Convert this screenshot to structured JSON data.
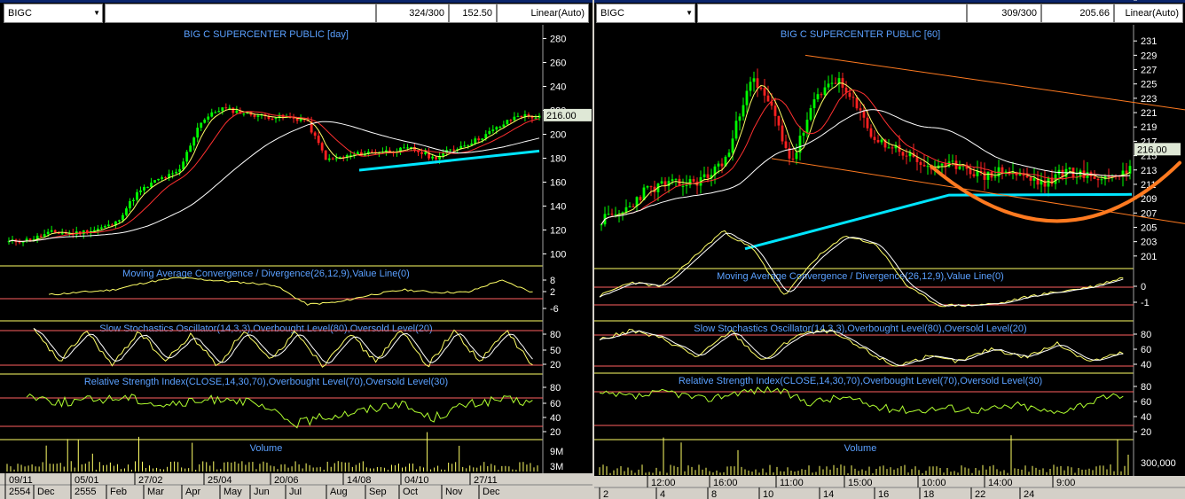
{
  "colors": {
    "bg": "#000000",
    "up": "#00ff00",
    "down": "#ff2020",
    "ma_short": "#ffff66",
    "ma_mid": "#ff3030",
    "ma_long": "#ffffff",
    "trend": "#00e5ff",
    "osc": "#ffff66",
    "osc2": "#ffffff",
    "rsi": "#b0ff30",
    "title": "#5aa0ff",
    "level": "#ff6060",
    "annot": "#ff7a20",
    "price_tag": "#dfe8d6"
  },
  "left": {
    "symbol": "BIGC",
    "count": "324/300",
    "price": "152.50",
    "scale": "Linear(Auto)",
    "title": "BIG C SUPERCENTER PUBLIC [day]",
    "last_price": "216.00",
    "y_ticks": [
      "280",
      "260",
      "240",
      "220",
      "200",
      "180",
      "160",
      "140",
      "120",
      "100"
    ],
    "macd_title": "Moving Average Convergence / Divergence(26,12,9),Value Line(0)",
    "macd_ticks": [
      "8",
      "2",
      "-6"
    ],
    "stoch_title": "Slow Stochastics Oscillator(14,3,3),Overbought Level(80),Oversold Level(20)",
    "stoch_ticks": [
      "80",
      "50",
      "20"
    ],
    "rsi_title": "Relative Strength Index(CLOSE,14,30,70),Overbought Level(70),Oversold Level(30)",
    "rsi_ticks": [
      "80",
      "60",
      "40",
      "20"
    ],
    "vol_title": "Volume",
    "vol_ticks": [
      "9M",
      "3M"
    ],
    "date_row1": [
      "09/11",
      "05/01",
      "27/02",
      "25/04",
      "20/06",
      "14/08",
      "04/10",
      "27/11"
    ],
    "date_row2": [
      "2554",
      "Dec",
      "2555",
      "Feb",
      "Mar",
      "Apr",
      "May",
      "Jun",
      "Jul",
      "Aug",
      "Sep",
      "Oct",
      "Nov",
      "Dec"
    ]
  },
  "right": {
    "symbol": "BIGC",
    "count": "309/300",
    "price": "205.66",
    "scale": "Linear(Auto)",
    "title": "BIG C SUPERCENTER PUBLIC [60]",
    "last_price": "216.00",
    "y_ticks": [
      "231",
      "229",
      "227",
      "225",
      "223",
      "221",
      "219",
      "217",
      "215",
      "213",
      "211",
      "209",
      "207",
      "205",
      "203",
      "201"
    ],
    "macd_title": "Moving Average Convergence / Divergence(26,12,9),Value Line(0)",
    "macd_ticks": [
      "0",
      "-1"
    ],
    "stoch_title": "Slow Stochastics Oscillator(14,3,3),Overbought Level(80),Oversold Level(20)",
    "stoch_ticks": [
      "80",
      "60",
      "40",
      "20"
    ],
    "rsi_title": "Relative Strength Index(CLOSE,14,30,70),Overbought Level(70),Oversold Level(30)",
    "rsi_ticks": [
      "80",
      "60",
      "40",
      "20"
    ],
    "vol_title": "Volume",
    "vol_ticks": [
      "300,000"
    ],
    "date_row1": [
      "12:00",
      "16:00",
      "11:00",
      "15:00",
      "10:00",
      "14:00",
      "9:00"
    ],
    "date_row2": [
      "2",
      "4",
      "8",
      "10",
      "14",
      "16",
      "18",
      "22",
      "24"
    ]
  },
  "chart_data": [
    {
      "type": "line",
      "title": "BIG C SUPERCENTER PUBLIC [day]",
      "xlabel": "",
      "ylabel": "",
      "ylim": [
        95,
        285
      ],
      "x": [
        "09/11",
        "05/01",
        "27/02",
        "25/04",
        "20/06",
        "14/08",
        "04/10",
        "27/11"
      ],
      "series": [
        {
          "name": "",
          "values": [
            112,
            118,
            162,
            210,
            212,
            178,
            188,
            216
          ]
        }
      ]
    },
    {
      "type": "line",
      "title": "BIG C SUPERCENTER PUBLIC [60]",
      "xlabel": "",
      "ylabel": "",
      "ylim": [
        200,
        232
      ],
      "x": [
        "12:00",
        "16:00",
        "11:00",
        "15:00",
        "10:00",
        "14:00",
        "9:00"
      ],
      "series": [
        {
          "name": "",
          "values": [
            206,
            210,
            226,
            225,
            216,
            212,
            216
          ]
        }
      ]
    }
  ]
}
